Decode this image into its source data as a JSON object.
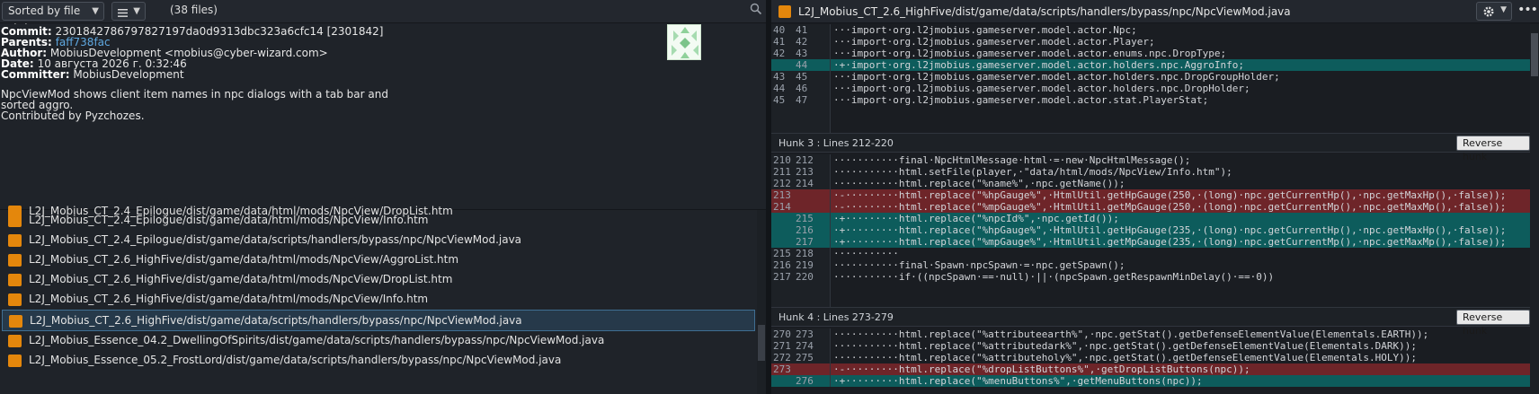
{
  "toolbar": {
    "sort_label": "Sorted by file status",
    "view_icon": "list-icon",
    "file_count": "(38 files)",
    "search_icon": "search-icon"
  },
  "commit": {
    "commit_label": "Commit:",
    "commit_value": "2301842786797827197da0d9313dbc323a6cfc14 [2301842]",
    "parents_label": "Parents:",
    "parents_value": "faff738fac",
    "author_label": "Author:",
    "author_value": "MobiusDevelopment <mobius@cyber-wizard.com>",
    "date_label": "Date:",
    "date_value": "10 августа 2026 г. 0:32:46",
    "committer_label": "Committer:",
    "committer_value": "MobiusDevelopment",
    "message": [
      "NpcViewMod shows client item names in npc dialogs with a tab bar and",
      "sorted aggro.",
      "Contributed by Pyzchozes."
    ]
  },
  "files": [
    {
      "path": "L2J_Mobius_CT_2.4_Epilogue/dist/game/data/html/mods/NpcView/DropList.htm",
      "selected": false
    },
    {
      "path": "L2J_Mobius_CT_2.4_Epilogue/dist/game/data/html/mods/NpcView/Info.htm",
      "selected": false
    },
    {
      "path": "L2J_Mobius_CT_2.4_Epilogue/dist/game/data/scripts/handlers/bypass/npc/NpcViewMod.java",
      "selected": false
    },
    {
      "path": "L2J_Mobius_CT_2.6_HighFive/dist/game/data/html/mods/NpcView/AggroList.htm",
      "selected": false
    },
    {
      "path": "L2J_Mobius_CT_2.6_HighFive/dist/game/data/html/mods/NpcView/DropList.htm",
      "selected": false
    },
    {
      "path": "L2J_Mobius_CT_2.6_HighFive/dist/game/data/html/mods/NpcView/Info.htm",
      "selected": false
    },
    {
      "path": "L2J_Mobius_CT_2.6_HighFive/dist/game/data/scripts/handlers/bypass/npc/NpcViewMod.java",
      "selected": true
    },
    {
      "path": "L2J_Mobius_Essence_04.2_DwellingOfSpirits/dist/game/data/scripts/handlers/bypass/npc/NpcViewMod.java",
      "selected": false
    },
    {
      "path": "L2J_Mobius_Essence_05.2_FrostLord/dist/game/data/scripts/handlers/bypass/npc/NpcViewMod.java",
      "selected": false
    }
  ],
  "diff_header": {
    "path": "L2J_Mobius_CT_2.6_HighFive/dist/game/data/scripts/handlers/bypass/npc/NpcViewMod.java",
    "gear_icon": "gear-icon",
    "more_icon": "more-icon",
    "more_label": "•••"
  },
  "hunks": [
    {
      "title": "",
      "lines": [
        {
          "o": "40",
          "n": "41",
          "t": "ctx",
          "code": "···import·org.l2jmobius.gameserver.model.actor.Npc;"
        },
        {
          "o": "41",
          "n": "42",
          "t": "ctx",
          "code": "···import·org.l2jmobius.gameserver.model.actor.Player;"
        },
        {
          "o": "42",
          "n": "43",
          "t": "ctx",
          "code": "···import·org.l2jmobius.gameserver.model.actor.enums.npc.DropType;"
        },
        {
          "o": "",
          "n": "44",
          "t": "add",
          "code": "·+·import·org.l2jmobius.gameserver.model.actor.holders.npc.AggroInfo;"
        },
        {
          "o": "43",
          "n": "45",
          "t": "ctx",
          "code": "···import·org.l2jmobius.gameserver.model.actor.holders.npc.DropGroupHolder;"
        },
        {
          "o": "44",
          "n": "46",
          "t": "ctx",
          "code": "···import·org.l2jmobius.gameserver.model.actor.holders.npc.DropHolder;"
        },
        {
          "o": "45",
          "n": "47",
          "t": "ctx",
          "code": "···import·org.l2jmobius.gameserver.model.actor.stat.PlayerStat;"
        }
      ]
    },
    {
      "title": "Hunk 3 : Lines 212-220",
      "button": "Reverse hunk",
      "lines": [
        {
          "o": "210",
          "n": "212",
          "t": "ctx",
          "code": "···········final·NpcHtmlMessage·html·=·new·NpcHtmlMessage();"
        },
        {
          "o": "211",
          "n": "213",
          "t": "ctx",
          "code": "···········html.setFile(player,·\"data/html/mods/NpcView/Info.htm\");"
        },
        {
          "o": "212",
          "n": "214",
          "t": "ctx",
          "code": "···········html.replace(\"%name%\",·npc.getName());"
        },
        {
          "o": "213",
          "n": "",
          "t": "rem",
          "code": "·-·········html.replace(\"%hpGauge%\",·HtmlUtil.getHpGauge(250,·(long)·npc.getCurrentHp(),·npc.getMaxHp(),·false));"
        },
        {
          "o": "214",
          "n": "",
          "t": "rem",
          "code": "·-·········html.replace(\"%mpGauge%\",·HtmlUtil.getMpGauge(250,·(long)·npc.getCurrentMp(),·npc.getMaxMp(),·false));"
        },
        {
          "o": "",
          "n": "215",
          "t": "add",
          "code": "·+·········html.replace(\"%npcId%\",·npc.getId());"
        },
        {
          "o": "",
          "n": "216",
          "t": "add",
          "code": "·+·········html.replace(\"%hpGauge%\",·HtmlUtil.getHpGauge(235,·(long)·npc.getCurrentHp(),·npc.getMaxHp(),·false));"
        },
        {
          "o": "",
          "n": "217",
          "t": "add",
          "code": "·+·········html.replace(\"%mpGauge%\",·HtmlUtil.getMpGauge(235,·(long)·npc.getCurrentMp(),·npc.getMaxMp(),·false));"
        },
        {
          "o": "215",
          "n": "218",
          "t": "ctx",
          "code": "···········"
        },
        {
          "o": "216",
          "n": "219",
          "t": "ctx",
          "code": "···········final·Spawn·npcSpawn·=·npc.getSpawn();"
        },
        {
          "o": "217",
          "n": "220",
          "t": "ctx",
          "code": "···········if·((npcSpawn·==·null)·||·(npcSpawn.getRespawnMinDelay()·==·0))"
        }
      ]
    },
    {
      "title": "Hunk 4 : Lines 273-279",
      "button": "Reverse hunk",
      "lines": [
        {
          "o": "270",
          "n": "273",
          "t": "ctx",
          "code": "···········html.replace(\"%attributeearth%\",·npc.getStat().getDefenseElementValue(Elementals.EARTH));"
        },
        {
          "o": "271",
          "n": "274",
          "t": "ctx",
          "code": "···········html.replace(\"%attributedark%\",·npc.getStat().getDefenseElementValue(Elementals.DARK));"
        },
        {
          "o": "272",
          "n": "275",
          "t": "ctx",
          "code": "···········html.replace(\"%attributeholy%\",·npc.getStat().getDefenseElementValue(Elementals.HOLY));"
        },
        {
          "o": "273",
          "n": "",
          "t": "rem",
          "code": "·-·········html.replace(\"%dropListButtons%\",·getDropListButtons(npc));"
        },
        {
          "o": "",
          "n": "276",
          "t": "add",
          "code": "·+·········html.replace(\"%menuButtons%\",·getMenuButtons(npc));"
        }
      ]
    }
  ]
}
